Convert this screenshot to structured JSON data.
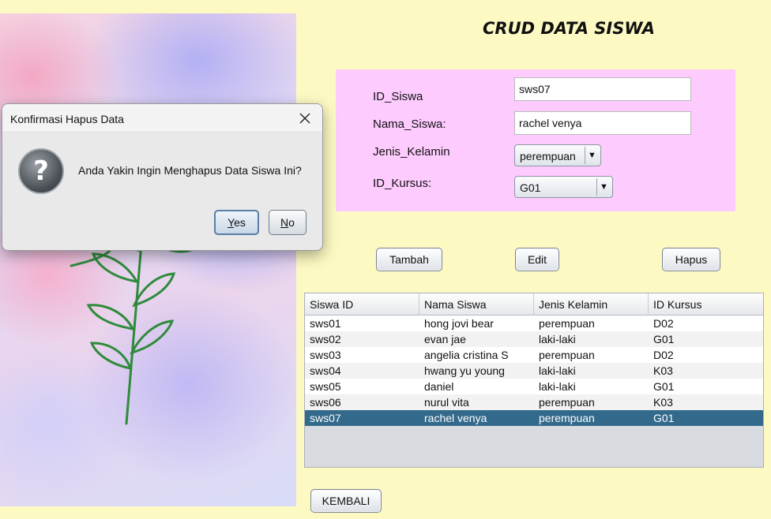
{
  "title": "CRUD DATA SISWA",
  "form": {
    "id_siswa_label": "ID_Siswa",
    "id_siswa_value": "sws07",
    "nama_siswa_label": "Nama_Siswa:",
    "nama_siswa_value": "rachel venya",
    "jenis_kelamin_label": "Jenis_Kelamin",
    "jenis_kelamin_value": "perempuan",
    "id_kursus_label": "ID_Kursus:",
    "id_kursus_value": "G01"
  },
  "buttons": {
    "tambah": "Tambah",
    "edit": "Edit",
    "hapus": "Hapus",
    "kembali": "KEMBALI"
  },
  "table": {
    "columns": [
      "Siswa ID",
      "Nama Siswa",
      "Jenis Kelamin",
      "ID Kursus"
    ],
    "rows": [
      [
        "sws01",
        "hong jovi bear",
        "perempuan",
        "D02"
      ],
      [
        "sws02",
        "evan jae",
        "laki-laki",
        "G01"
      ],
      [
        "sws03",
        "angelia cristina S",
        "perempuan",
        "D02"
      ],
      [
        "sws04",
        "hwang yu young",
        "laki-laki",
        "K03"
      ],
      [
        "sws05",
        "daniel",
        "laki-laki",
        "G01"
      ],
      [
        "sws06",
        "nurul vita",
        "perempuan",
        "K03"
      ],
      [
        "sws07",
        "rachel venya",
        "perempuan",
        "G01"
      ]
    ],
    "selected_row": 6
  },
  "dialog": {
    "title": "Konfirmasi Hapus Data",
    "message": "Anda Yakin Ingin Menghapus Data Siswa Ini?",
    "yes_mnemonic": "Y",
    "yes_rest": "es",
    "no_mnemonic": "N",
    "no_rest": "o",
    "close_icon": "close-icon",
    "question_icon": "question-icon"
  },
  "colors": {
    "background": "#fdf9c3",
    "form_panel": "#fecbff",
    "selected_row": "#336a8b"
  }
}
